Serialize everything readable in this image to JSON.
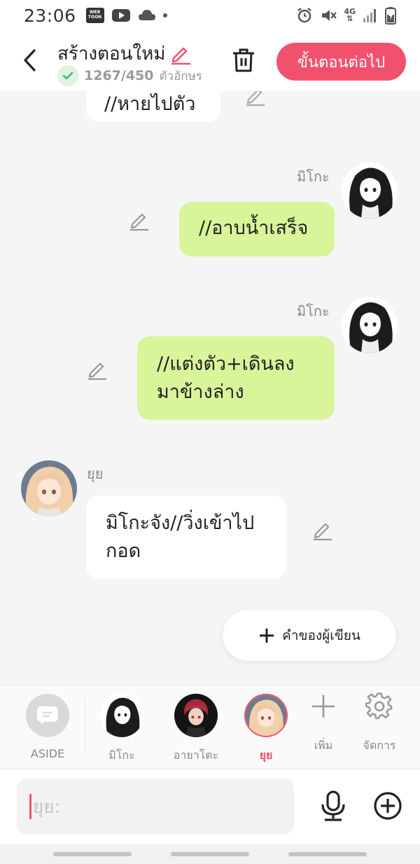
{
  "status_bar": {
    "time": "23:06",
    "webtoon_badge": "WEB TOON",
    "network": "4G"
  },
  "header": {
    "title": "สร้างตอนใหม่",
    "char_count": "1267/450",
    "char_unit": "ตัวอักษร",
    "next_button": "ขั้นตอนต่อไป"
  },
  "messages": [
    {
      "speaker": "",
      "text_lines": [
        "//หายไปตัว"
      ],
      "style": "partial-white"
    },
    {
      "speaker": "มิโกะ",
      "text_lines": [
        "//อาบน้ำเสร็จ"
      ],
      "style": "green"
    },
    {
      "speaker": "มิโกะ",
      "text_lines": [
        "//แต่งตัว+เดินลง",
        "มาข้างล่าง"
      ],
      "style": "green"
    },
    {
      "speaker": "ยุย",
      "text_lines": [
        "มิโกะจัง//วิ่งเข้าไป",
        "กอด"
      ],
      "style": "white"
    }
  ],
  "author_note_button": "คำของผู้เขียน",
  "character_bar": {
    "aside_label": "ASIDE",
    "characters": [
      {
        "name": "มิโกะ",
        "active": false
      },
      {
        "name": "อายาโตะ",
        "active": false
      },
      {
        "name": "ยุย",
        "active": true
      }
    ],
    "add_label": "เพิ่ม",
    "manage_label": "จัดการ"
  },
  "input": {
    "placeholder": "ยุย:"
  },
  "colors": {
    "accent": "#f2516d",
    "green_bubble": "#d8f59a",
    "white_bubble": "#ffffff",
    "background": "#f5f5f5"
  }
}
